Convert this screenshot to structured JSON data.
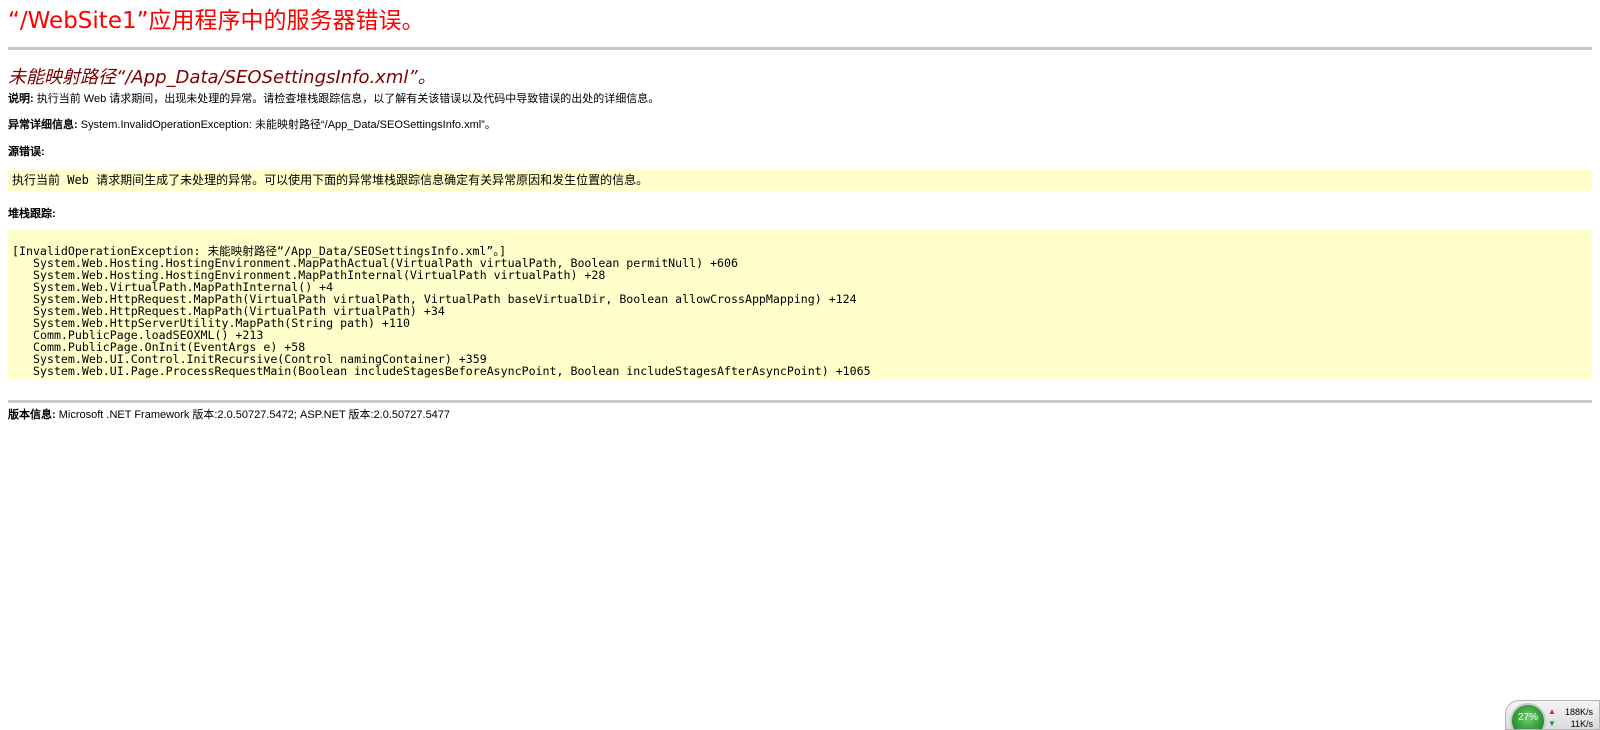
{
  "app_title": "“/WebSite1”应用程序中的服务器错误。",
  "error_heading": "未能映射路径“/App_Data/SEOSettingsInfo.xml”。",
  "description": {
    "label": "说明:",
    "text": " 执行当前 Web 请求期间，出现未处理的异常。请检查堆栈跟踪信息，以了解有关该错误以及代码中导致错误的出处的详细信息。"
  },
  "exception_details": {
    "label": "异常详细信息:",
    "text": " System.InvalidOperationException: 未能映射路径“/App_Data/SEOSettingsInfo.xml”。"
  },
  "source_error": {
    "label": "源错误:",
    "text": "执行当前 Web 请求期间生成了未处理的异常。可以使用下面的异常堆栈跟踪信息确定有关异常原因和发生位置的信息。"
  },
  "stack_trace": {
    "label": "堆栈跟踪:",
    "header": "[InvalidOperationException: 未能映射路径“/App_Data/SEOSettingsInfo.xml”。]",
    "frames": [
      "System.Web.Hosting.HostingEnvironment.MapPathActual(VirtualPath virtualPath, Boolean permitNull) +606",
      "System.Web.Hosting.HostingEnvironment.MapPathInternal(VirtualPath virtualPath) +28",
      "System.Web.VirtualPath.MapPathInternal() +4",
      "System.Web.HttpRequest.MapPath(VirtualPath virtualPath, VirtualPath baseVirtualDir, Boolean allowCrossAppMapping) +124",
      "System.Web.HttpRequest.MapPath(VirtualPath virtualPath) +34",
      "System.Web.HttpServerUtility.MapPath(String path) +110",
      "Comm.PublicPage.loadSEOXML() +213",
      "Comm.PublicPage.OnInit(EventArgs e) +58",
      "System.Web.UI.Control.InitRecursive(Control namingContainer) +359",
      "System.Web.UI.Page.ProcessRequestMain(Boolean includeStagesBeforeAsyncPoint, Boolean includeStagesAfterAsyncPoint) +1065"
    ]
  },
  "version_info": {
    "label": "版本信息:",
    "text": " Microsoft .NET Framework 版本:2.0.50727.5472; ASP.NET 版本:2.0.50727.5477"
  },
  "network_widget": {
    "percent": "27%",
    "up_rate": "188K/s",
    "down_rate": "11K/s",
    "up_icon": "arrow-up-icon",
    "down_icon": "arrow-down-icon"
  },
  "colors": {
    "title": "#ff0000",
    "heading": "#800000",
    "code_background": "#ffffcc",
    "divider": "#c8c8c8"
  }
}
